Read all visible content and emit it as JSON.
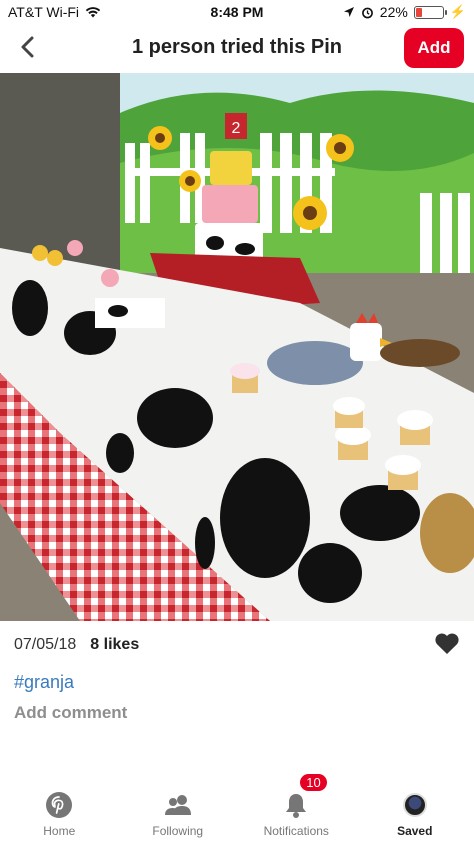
{
  "status_bar": {
    "carrier": "AT&T Wi-Fi",
    "time": "8:48 PM",
    "battery_percent": "22%",
    "battery_level": 0.22
  },
  "header": {
    "title": "1 person tried this Pin",
    "add_label": "Add",
    "accent": "#e60023"
  },
  "pin": {
    "date": "07/05/18",
    "likes": "8 likes",
    "hashtag": "#granja",
    "add_comment": "Add comment"
  },
  "tabs": [
    {
      "label": "Home",
      "icon": "pinterest-logo-icon"
    },
    {
      "label": "Following",
      "icon": "people-icon"
    },
    {
      "label": "Notifications",
      "icon": "bell-icon",
      "badge": "10"
    },
    {
      "label": "Saved",
      "icon": "avatar"
    }
  ]
}
